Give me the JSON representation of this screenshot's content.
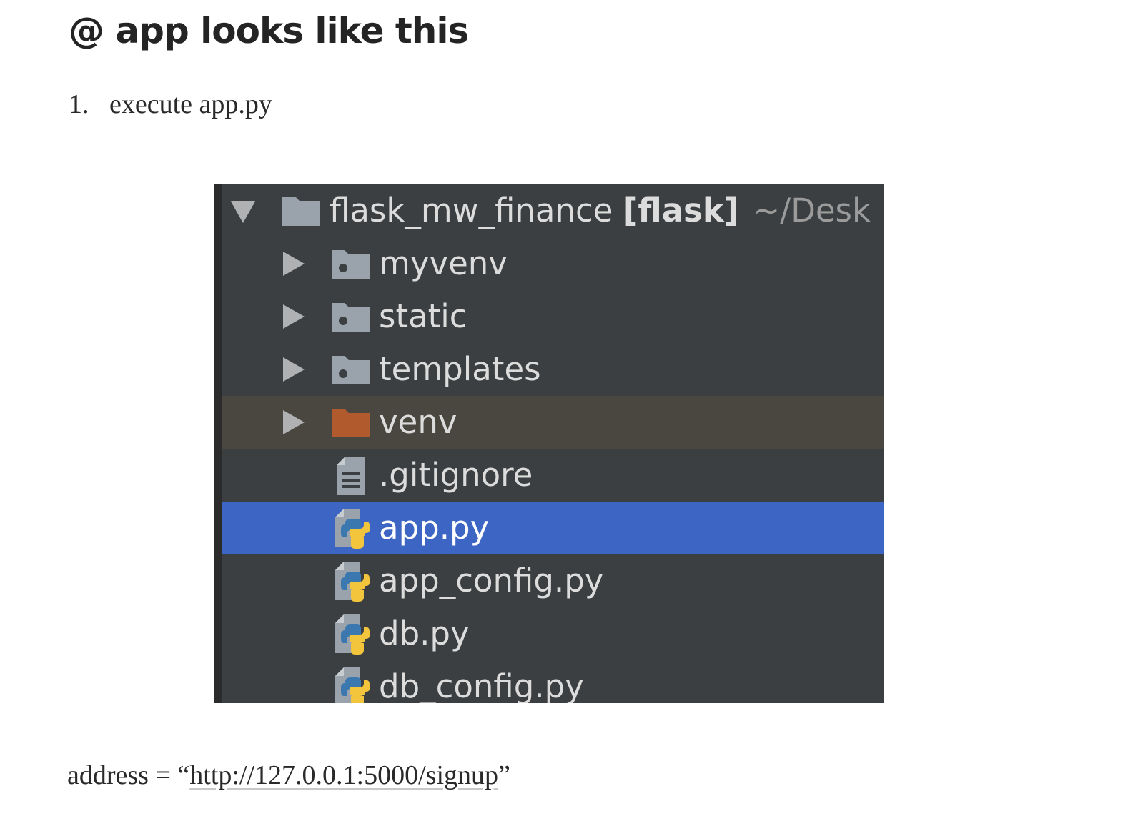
{
  "heading": "@ app looks like this",
  "step": {
    "number": "1.",
    "text": "execute app.py"
  },
  "tree": {
    "root": {
      "name": "flask_mw_finance",
      "module": "[flask]",
      "path": "~/Desk"
    },
    "items": [
      {
        "name": "myvenv",
        "kind": "folder",
        "icon": "source-folder-icon"
      },
      {
        "name": "static",
        "kind": "folder",
        "icon": "source-folder-icon"
      },
      {
        "name": "templates",
        "kind": "folder",
        "icon": "source-folder-icon"
      },
      {
        "name": "venv",
        "kind": "folder",
        "icon": "excluded-folder-icon"
      },
      {
        "name": ".gitignore",
        "kind": "file",
        "icon": "text-file-icon"
      },
      {
        "name": "app.py",
        "kind": "file",
        "icon": "python-file-icon",
        "selected": true
      },
      {
        "name": "app_config.py",
        "kind": "file",
        "icon": "python-file-icon"
      },
      {
        "name": "db.py",
        "kind": "file",
        "icon": "python-file-icon"
      },
      {
        "name": "db_config.py",
        "kind": "file",
        "icon": "python-file-icon"
      }
    ]
  },
  "address": {
    "prefix": "address = “",
    "url": "http://127.0.0.1:5000/signup",
    "suffix": "”"
  },
  "colors": {
    "panel_bg": "#3c3f41",
    "selection": "#3d65c4",
    "excluded_row": "#4a4741",
    "excluded_folder": "#b05a2e",
    "folder": "#9aa3ab"
  }
}
